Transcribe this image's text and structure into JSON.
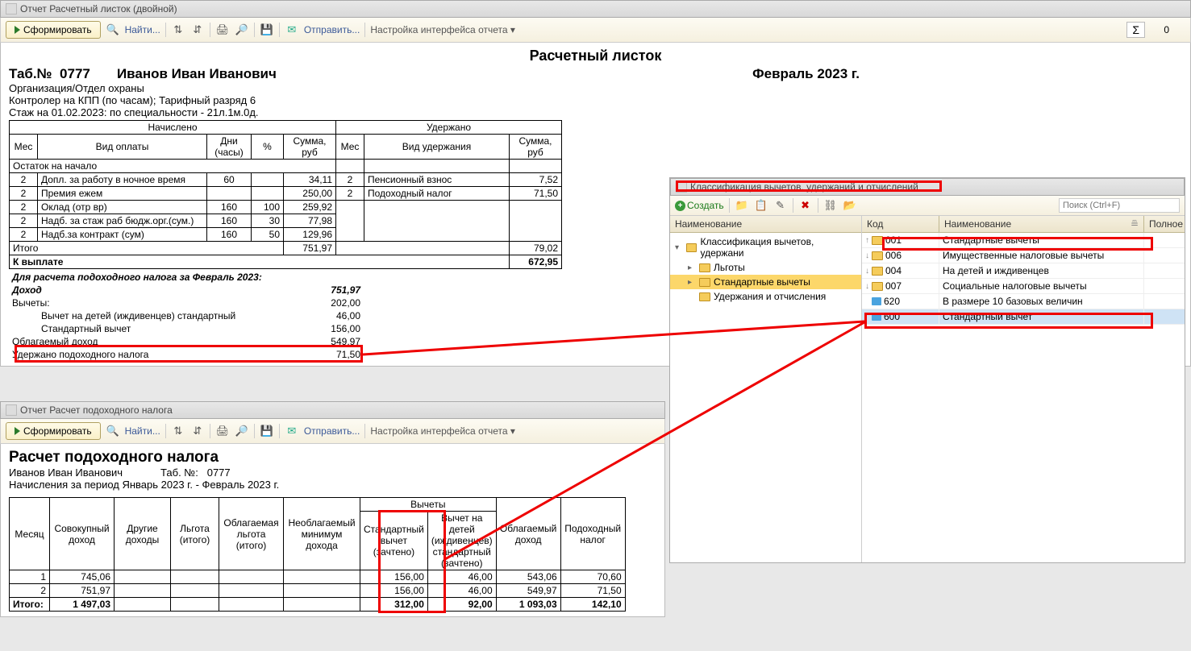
{
  "window1": {
    "title": "Отчет Расчетный листок (двойной)"
  },
  "window2": {
    "title": "Отчет Расчет подоходного налога"
  },
  "window3": {
    "title": "Классификация вычетов, удержаний и отчислений"
  },
  "toolbar": {
    "form": "Сформировать",
    "find": "Найти...",
    "send": "Отправить...",
    "cfg": "Настройка интерфейса отчета",
    "create": "Создать",
    "search_ph": "Поиск (Ctrl+F)",
    "sigma": "Σ",
    "sigma_val": "0"
  },
  "rep1": {
    "title": "Расчетный листок",
    "tabno_lbl": "Таб.№",
    "tabno": "0777",
    "name": "Иванов Иван Иванович",
    "period": "Февраль 2023 г.",
    "org": "Организация/Отдел охраны",
    "pos": "Контролер на КПП (по часам); Тарифный разряд 6",
    "exp": "Стаж на 01.02.2023: по специальности - 21л.1м.0д.",
    "hdr_accr": "Начислено",
    "hdr_ded": "Удержано",
    "col_mes": "Мес",
    "col_vid": "Вид оплаты",
    "col_dni": "Дни (часы)",
    "col_pct": "%",
    "col_sum": "Сумма, руб",
    "col_vidud": "Вид удержания",
    "ost": "Остаток на начало",
    "a1": {
      "m": "2",
      "n": "Допл. за работу в ночное время",
      "d": "60",
      "p": "",
      "s": "34,11"
    },
    "a2": {
      "m": "2",
      "n": "Премия ежем",
      "d": "",
      "p": "",
      "s": "250,00"
    },
    "a3": {
      "m": "2",
      "n": "Оклад (отр вр)",
      "d": "160",
      "p": "100",
      "s": "259,92"
    },
    "a4": {
      "m": "2",
      "n": "Надб. за стаж раб бюдж.орг.(сум.)",
      "d": "160",
      "p": "30",
      "s": "77,98"
    },
    "a5": {
      "m": "2",
      "n": "Надб.за контракт (сум)",
      "d": "160",
      "p": "50",
      "s": "129,96"
    },
    "d1": {
      "m": "2",
      "n": "Пенсионный взнос",
      "s": "7,52"
    },
    "d2": {
      "m": "2",
      "n": "Подоходный налог",
      "s": "71,50"
    },
    "itogo": "Итого",
    "itogo_a": "751,97",
    "itogo_d": "79,02",
    "kvyp": "К выплате",
    "kvyp_s": "672,95",
    "calc_hdr": "Для расчета подоходного налога за Февраль 2023:",
    "dohod": "Доход",
    "dohod_s": "751,97",
    "vych": "Вычеты:",
    "vych_s": "202,00",
    "vdet": "Вычет на детей (иждивенцев) стандартный",
    "vdet_s": "46,00",
    "vstd": "Стандартный вычет",
    "vstd_s": "156,00",
    "obl": "Облагаемый доход",
    "obl_s": "549,97",
    "ud": "Удержано подоходного налога",
    "ud_s": "71,50"
  },
  "rep2": {
    "title": "Расчет подоходного налога",
    "name": "Иванов Иван Иванович",
    "tab_lbl": "Таб. №:",
    "tab": "0777",
    "period": "Начисления за период Январь 2023 г. - Февраль 2023 г.",
    "c_mes": "Месяц",
    "c_sov": "Совокупный доход",
    "c_dr": "Другие доходы",
    "c_lg": "Льгота (итого)",
    "c_oblg": "Облагаемая льгота (итого)",
    "c_min": "Необлагаемый минимум дохода",
    "c_vych": "Вычеты",
    "c_std": "Стандартный вычет (зачтено)",
    "c_det": "Вычет на детей (иждивенцев) стандартный (зачтено)",
    "c_obld": "Облагаемый доход",
    "c_tax": "Подоходный налог",
    "r1": {
      "m": "1",
      "sov": "745,06",
      "std": "156,00",
      "det": "46,00",
      "obl": "543,06",
      "tax": "70,60"
    },
    "r2": {
      "m": "2",
      "sov": "751,97",
      "std": "156,00",
      "det": "46,00",
      "obl": "549,97",
      "tax": "71,50"
    },
    "tot": {
      "m": "Итого:",
      "sov": "1 497,03",
      "std": "312,00",
      "det": "92,00",
      "obl": "1 093,03",
      "tax": "142,10"
    }
  },
  "tree": {
    "hdr_name": "Наименование",
    "hdr_code": "Код",
    "hdr_full": "Полное",
    "root": "Классификация вычетов, удержани",
    "n1": "Льготы",
    "n2": "Стандартные вычеты",
    "n3": "Удержания и отчисления",
    "i1": {
      "c": "001",
      "n": "Стандартные вычеты"
    },
    "i2": {
      "c": "006",
      "n": "Имущественные налоговые вычеты"
    },
    "i3": {
      "c": "004",
      "n": "На детей и иждивенцев"
    },
    "i4": {
      "c": "007",
      "n": "Социальные налоговые вычеты"
    },
    "i5": {
      "c": "620",
      "n": "В размере 10 базовых величин"
    },
    "i6": {
      "c": "600",
      "n": "Стандартный вычет"
    }
  }
}
